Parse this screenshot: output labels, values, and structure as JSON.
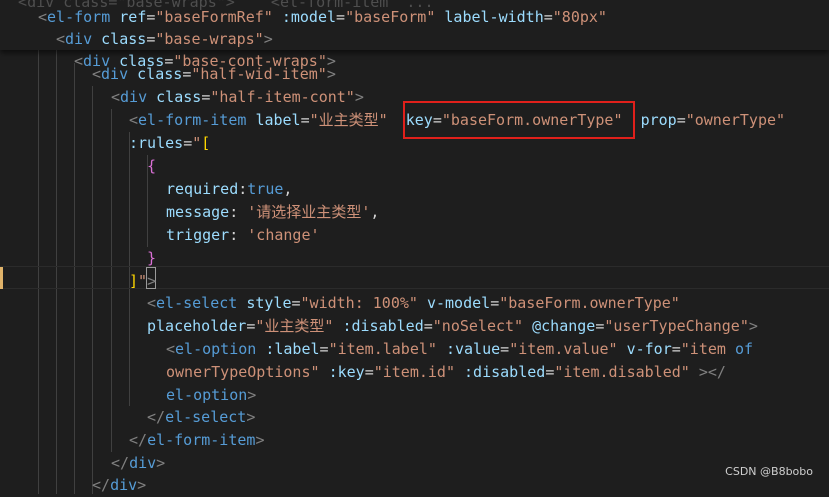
{
  "editor": {
    "sticky_partial": "  <div class=\"base-wraps\">    <el-form-item  ...",
    "lines": [
      [
        [
          "ang",
          "<"
        ],
        [
          "tag",
          "el-form"
        ],
        [
          "punc",
          " "
        ],
        [
          "attr",
          "ref"
        ],
        [
          "punc",
          "="
        ],
        [
          "str",
          "\"baseFormRef\""
        ],
        [
          "punc",
          " "
        ],
        [
          "attr",
          ":model"
        ],
        [
          "punc",
          "="
        ],
        [
          "str",
          "\"baseForm\""
        ],
        [
          "punc",
          " "
        ],
        [
          "attr",
          "label-width"
        ],
        [
          "punc",
          "="
        ],
        [
          "str",
          "\"80px\""
        ]
      ],
      [
        [
          "ang",
          "<"
        ],
        [
          "tag",
          "div"
        ],
        [
          "punc",
          " "
        ],
        [
          "attr",
          "class"
        ],
        [
          "punc",
          "="
        ],
        [
          "str",
          "\"base-wraps\""
        ],
        [
          "ang",
          ">"
        ]
      ],
      [
        [
          "ang",
          "<"
        ],
        [
          "tag",
          "div"
        ],
        [
          "punc",
          " "
        ],
        [
          "attr",
          "class"
        ],
        [
          "punc",
          "="
        ],
        [
          "str",
          "\"base-cont-wraps\""
        ],
        [
          "ang",
          ">"
        ]
      ],
      [
        [
          "ang",
          "<"
        ],
        [
          "tag",
          "div"
        ],
        [
          "punc",
          " "
        ],
        [
          "attr",
          "class"
        ],
        [
          "punc",
          "="
        ],
        [
          "str",
          "\"half-wid-item\""
        ],
        [
          "ang",
          ">"
        ]
      ],
      [
        [
          "ang",
          "<"
        ],
        [
          "tag",
          "div"
        ],
        [
          "punc",
          " "
        ],
        [
          "attr",
          "class"
        ],
        [
          "punc",
          "="
        ],
        [
          "str",
          "\"half-item-cont\""
        ],
        [
          "ang",
          ">"
        ]
      ],
      [
        [
          "ang",
          "<"
        ],
        [
          "tag",
          "el-form-item"
        ],
        [
          "punc",
          " "
        ],
        [
          "attr",
          "label"
        ],
        [
          "punc",
          "="
        ],
        [
          "str",
          "\"业主类型\""
        ],
        [
          "punc",
          "  "
        ],
        [
          "attr",
          "key"
        ],
        [
          "punc",
          "="
        ],
        [
          "str",
          "\"baseForm.ownerType\""
        ],
        [
          "punc",
          "  "
        ],
        [
          "attr",
          "prop"
        ],
        [
          "punc",
          "="
        ],
        [
          "str",
          "\"ownerType\""
        ]
      ],
      [
        [
          "attr",
          ":rules"
        ],
        [
          "punc",
          "="
        ],
        [
          "str",
          "\""
        ],
        [
          "b1",
          "["
        ]
      ],
      [
        [
          "b2",
          "{"
        ]
      ],
      [
        [
          "attr",
          "required"
        ],
        [
          "punc",
          ":"
        ],
        [
          "kw",
          "true"
        ],
        [
          "punc",
          ","
        ]
      ],
      [
        [
          "attr",
          "message"
        ],
        [
          "punc",
          ": "
        ],
        [
          "str",
          "'请选择业主类型'"
        ],
        [
          "punc",
          ","
        ]
      ],
      [
        [
          "attr",
          "trigger"
        ],
        [
          "punc",
          ": "
        ],
        [
          "str",
          "'change'"
        ]
      ],
      [
        [
          "b2",
          "}"
        ]
      ],
      [
        [
          "b1",
          "]"
        ],
        [
          "str",
          "\""
        ],
        [
          "ang",
          ">"
        ]
      ],
      [
        [
          "ang",
          "<"
        ],
        [
          "tag",
          "el-select"
        ],
        [
          "punc",
          " "
        ],
        [
          "attr",
          "style"
        ],
        [
          "punc",
          "="
        ],
        [
          "str",
          "\"width: 100%\""
        ],
        [
          "punc",
          " "
        ],
        [
          "attr",
          "v-model"
        ],
        [
          "punc",
          "="
        ],
        [
          "str",
          "\"baseForm.ownerType\""
        ]
      ],
      [
        [
          "attr",
          "placeholder"
        ],
        [
          "punc",
          "="
        ],
        [
          "str",
          "\"业主类型\""
        ],
        [
          "punc",
          " "
        ],
        [
          "attr",
          ":disabled"
        ],
        [
          "punc",
          "="
        ],
        [
          "str",
          "\"noSelect\""
        ],
        [
          "punc",
          " "
        ],
        [
          "attr",
          "@change"
        ],
        [
          "punc",
          "="
        ],
        [
          "str",
          "\"userTypeChange\""
        ],
        [
          "ang",
          ">"
        ]
      ],
      [
        [
          "ang",
          "<"
        ],
        [
          "tag",
          "el-option"
        ],
        [
          "punc",
          " "
        ],
        [
          "attr",
          ":label"
        ],
        [
          "punc",
          "="
        ],
        [
          "str",
          "\"item.label\""
        ],
        [
          "punc",
          " "
        ],
        [
          "attr",
          ":value"
        ],
        [
          "punc",
          "="
        ],
        [
          "str",
          "\"item.value\""
        ],
        [
          "punc",
          " "
        ],
        [
          "attr",
          "v-for"
        ],
        [
          "punc",
          "="
        ],
        [
          "str",
          "\"item "
        ],
        [
          "kw",
          "of"
        ]
      ],
      [
        [
          "str",
          "ownerTypeOptions\""
        ],
        [
          "punc",
          " "
        ],
        [
          "attr",
          ":key"
        ],
        [
          "punc",
          "="
        ],
        [
          "str",
          "\"item.id\""
        ],
        [
          "punc",
          " "
        ],
        [
          "attr",
          ":disabled"
        ],
        [
          "punc",
          "="
        ],
        [
          "str",
          "\"item.disabled\""
        ],
        [
          "punc",
          " "
        ],
        [
          "ang",
          "></"
        ]
      ],
      [
        [
          "tag",
          "el-option"
        ],
        [
          "ang",
          ">"
        ]
      ],
      [
        [
          "ang",
          "</"
        ],
        [
          "tag",
          "el-select"
        ],
        [
          "ang",
          ">"
        ]
      ],
      [
        [
          "ang",
          "</"
        ],
        [
          "tag",
          "el-form-item"
        ],
        [
          "ang",
          ">"
        ]
      ],
      [
        [
          "ang",
          "</"
        ],
        [
          "tag",
          "div"
        ],
        [
          "ang",
          ">"
        ]
      ],
      [
        [
          "ang",
          "</"
        ],
        [
          "tag",
          "div"
        ],
        [
          "ang",
          ">"
        ]
      ]
    ]
  },
  "watermark": "CSDN @B8bobo"
}
